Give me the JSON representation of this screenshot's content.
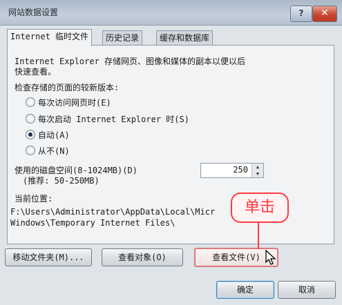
{
  "window": {
    "title": "网站数据设置",
    "help_label": "?",
    "close_label": "✕"
  },
  "tabs": [
    {
      "label": "Internet 临时文件"
    },
    {
      "label": "历史记录"
    },
    {
      "label": "缓存和数据库"
    }
  ],
  "temp_files": {
    "description_line1": "Internet Explorer 存储网页、图像和媒体的副本以便以后",
    "description_line2": "快速查看。",
    "check_label": "检查存储的页面的较新版本:",
    "options": [
      {
        "label": "每次访问网页时(E)",
        "selected": false
      },
      {
        "label": "每次启动 Internet Explorer 时(S)",
        "selected": false
      },
      {
        "label": "自动(A)",
        "selected": true
      },
      {
        "label": "从不(N)",
        "selected": false
      }
    ],
    "disk_label_line1": "使用的磁盘空间(8-1024MB)(D)",
    "disk_label_line2": "(推荐: 50-250MB)",
    "disk_value": "250",
    "location_label": "当前位置:",
    "location_line1": "F:\\Users\\Administrator\\AppData\\Local\\Micr",
    "location_line2": "Windows\\Temporary Internet Files\\",
    "buttons": {
      "move_folder": "移动文件夹(M)...",
      "view_objects": "查看对象(O)",
      "view_files": "查看文件(V)"
    }
  },
  "footer": {
    "ok": "确定",
    "cancel": "取消"
  },
  "annotation": {
    "callout_text": "单击"
  },
  "icons": {
    "help": "help-icon",
    "close": "close-icon",
    "cursor": "mouse-pointer-icon"
  },
  "colors": {
    "callout": "#ff3b3f",
    "close_button": "#c7462f"
  }
}
